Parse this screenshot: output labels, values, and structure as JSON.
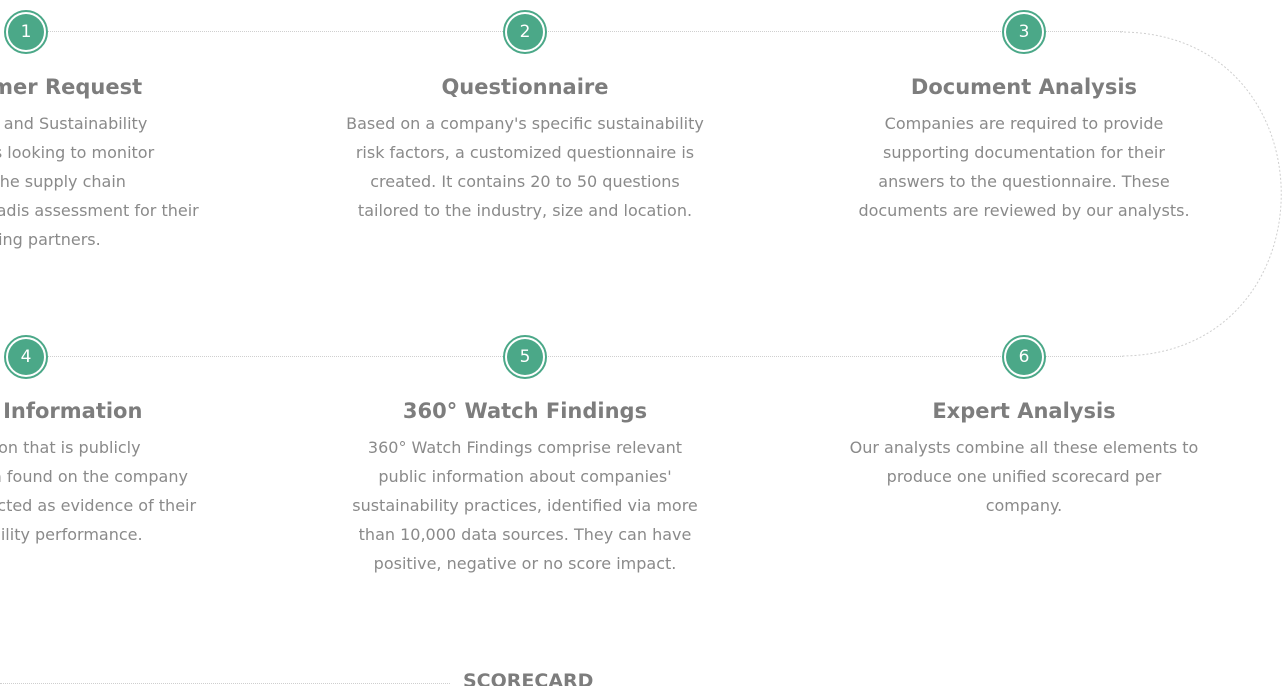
{
  "steps": [
    {
      "number": "1",
      "title": "Customer Request",
      "lines": [
        "CSR, EHS, and Sustainability",
        "enterprises looking to monitor",
        "risk in the supply chain",
        "request an EcoVadis assessment for their",
        "trading partners."
      ]
    },
    {
      "number": "2",
      "title": "Questionnaire",
      "lines": [
        "Based on a company's specific sustainability",
        "risk factors, a customized questionnaire is",
        "created. It contains 20 to 50 questions",
        "tailored to the industry, size and location."
      ]
    },
    {
      "number": "3",
      "title": "Document Analysis",
      "lines": [
        "Companies are required to provide",
        "supporting documentation for their",
        "answers to the questionnaire. These",
        "documents are reviewed by our analysts."
      ]
    },
    {
      "number": "4",
      "title": "Public Information",
      "lines": [
        "Information that is publicly",
        "available, often found on the company",
        "website, is collected as evidence of their",
        "sustainability performance."
      ]
    },
    {
      "number": "5",
      "title": "360° Watch Findings",
      "lines": [
        "360° Watch Findings comprise relevant",
        "public information about companies'",
        "sustainability practices, identified via more",
        "than 10,000 data sources. They can have",
        "positive, negative or no score impact."
      ]
    },
    {
      "number": "6",
      "title": "Expert Analysis",
      "lines": [
        "Our analysts combine all these elements to",
        "produce one unified scorecard per",
        "company."
      ]
    }
  ],
  "scorecard_label": "SCORECARD",
  "colors": {
    "accent": "#4ba888",
    "heading": "#7d7d7d",
    "body": "#8a8a8a",
    "dotted_line": "#cfcfcf"
  }
}
